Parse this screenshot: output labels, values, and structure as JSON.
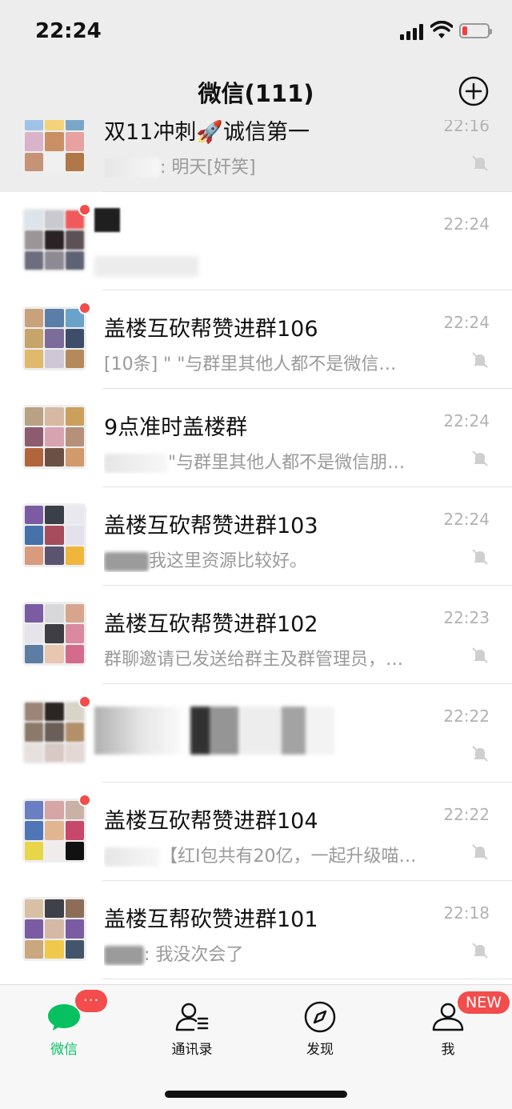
{
  "status_bar": {
    "time": "22:24"
  },
  "nav": {
    "title": "微信(111)"
  },
  "chats": [
    {
      "name": "双11冲刺🚀诚信第一",
      "time": "22:16",
      "preview": ": 明天[奸笑]",
      "muted": true,
      "unread": false,
      "pinned": true
    },
    {
      "name": "",
      "time": "22:24",
      "preview": "",
      "muted": false,
      "unread": true,
      "pinned": false
    },
    {
      "name": "盖楼互砍帮赞进群106",
      "time": "22:24",
      "preview": "[10条] \"     \"与群里其他人都不是微信…",
      "muted": true,
      "unread": true,
      "pinned": false
    },
    {
      "name": "9点准时盖楼群",
      "time": "22:24",
      "preview": "\"与群里其他人都不是微信朋…",
      "muted": true,
      "unread": false,
      "pinned": false
    },
    {
      "name": "盖楼互砍帮赞进群103",
      "time": "22:24",
      "preview": "我这里资源比较好。",
      "muted": true,
      "unread": false,
      "pinned": false
    },
    {
      "name": "盖楼互砍帮赞进群102",
      "time": "22:23",
      "preview": "群聊邀请已发送给群主及群管理员，…",
      "muted": true,
      "unread": false,
      "pinned": false
    },
    {
      "name": "",
      "time": "22:22",
      "preview": "",
      "muted": true,
      "unread": true,
      "pinned": false
    },
    {
      "name": "盖楼互砍帮赞进群104",
      "time": "22:22",
      "preview": "【红I包共有20亿，一起升级喵…",
      "muted": true,
      "unread": true,
      "pinned": false
    },
    {
      "name": "盖楼互帮砍赞进群101",
      "time": "22:18",
      "preview": ": 我没次会了",
      "muted": true,
      "unread": false,
      "pinned": false
    }
  ],
  "tabs": [
    {
      "label": "微信",
      "icon": "chat-bubble-icon",
      "badge": "···",
      "active": true
    },
    {
      "label": "通讯录",
      "icon": "contacts-icon",
      "badge": "",
      "active": false
    },
    {
      "label": "发现",
      "icon": "compass-icon",
      "badge": "",
      "active": false
    },
    {
      "label": "我",
      "icon": "person-icon",
      "badge": "NEW",
      "active": false
    }
  ],
  "colors": {
    "accent": "#07c160",
    "badge": "#f24c4c",
    "background": "#ededed"
  }
}
